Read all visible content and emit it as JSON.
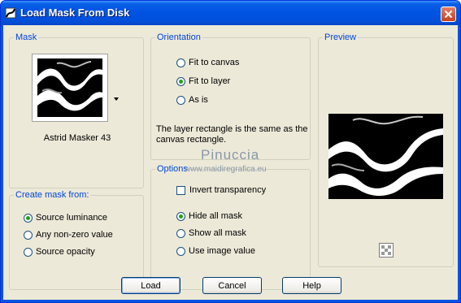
{
  "window": {
    "title": "Load Mask From Disk"
  },
  "mask": {
    "legend": "Mask",
    "name": "Astrid Masker 43"
  },
  "create_from": {
    "legend": "Create mask from:",
    "options": [
      {
        "label": "Source luminance",
        "checked": true
      },
      {
        "label": "Any non-zero value",
        "checked": false
      },
      {
        "label": "Source opacity",
        "checked": false
      }
    ]
  },
  "orientation": {
    "legend": "Orientation",
    "options": [
      {
        "label": "Fit to canvas",
        "checked": false
      },
      {
        "label": "Fit to layer",
        "checked": true
      },
      {
        "label": "As is",
        "checked": false
      }
    ],
    "note": "The layer rectangle is the same as the canvas rectangle."
  },
  "options": {
    "legend": "Options",
    "invert_label": "Invert transparency",
    "invert_checked": false,
    "choices": [
      {
        "label": "Hide all mask",
        "checked": true
      },
      {
        "label": "Show all mask",
        "checked": false
      },
      {
        "label": "Use image value",
        "checked": false
      }
    ]
  },
  "preview": {
    "legend": "Preview"
  },
  "watermark": {
    "name": "Pinuccia",
    "url": "www.maidiregrafica.eu"
  },
  "buttons": {
    "load": "Load",
    "cancel": "Cancel",
    "help": "Help"
  }
}
